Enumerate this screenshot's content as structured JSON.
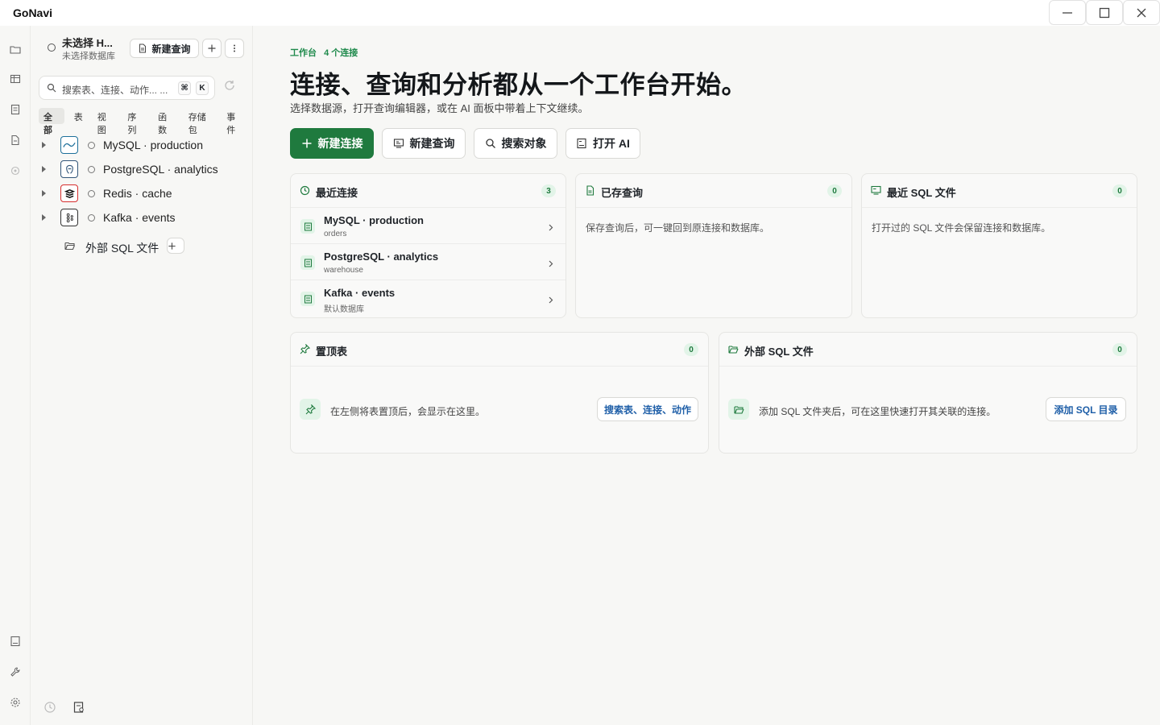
{
  "app": {
    "title": "GoNavi"
  },
  "window_controls": [
    "minimize-icon",
    "maximize-icon",
    "close-icon"
  ],
  "rail": {
    "top_icons": [
      "folder-icon",
      "table-icon",
      "list-icon",
      "document-icon",
      "target-icon"
    ],
    "bottom_icons": [
      "ai-panel-icon",
      "wrench-icon",
      "gear-icon"
    ]
  },
  "sidebar": {
    "connection_name": "未选择 H...",
    "connection_db": "未选择数据库",
    "new_query_label": "新建查询",
    "search_placeholder": "搜索表、连接、动作... ...",
    "kbd_cmd": "⌘",
    "kbd_k": "K",
    "filters": [
      "全部",
      "表",
      "视图",
      "序列",
      "函数",
      "存储包",
      "事件"
    ],
    "active_filter": "全部",
    "tree": [
      {
        "label": "MySQL · production",
        "logo": "mysql"
      },
      {
        "label": "PostgreSQL · analytics",
        "logo": "postgresql"
      },
      {
        "label": "Redis · cache",
        "logo": "redis"
      },
      {
        "label": "Kafka · events",
        "logo": "kafka"
      }
    ],
    "external_sql_label": "外部 SQL 文件"
  },
  "main": {
    "crumb_workspace": "工作台",
    "crumb_count": "4 个连接",
    "hero": "连接、查询和分析都从一个工作台开始。",
    "subtitle": "选择数据源，打开查询编辑器，或在 AI 面板中带着上下文继续。",
    "buttons": {
      "new_connection": "新建连接",
      "new_query": "新建查询",
      "search_objects": "搜索对象",
      "open_ai": "打开 AI"
    },
    "recent_connections": {
      "title": "最近连接",
      "count": "3",
      "items": [
        {
          "name": "MySQL · production",
          "db": "orders"
        },
        {
          "name": "PostgreSQL · analytics",
          "db": "warehouse"
        },
        {
          "name": "Kafka · events",
          "db": "默认数据库"
        }
      ]
    },
    "saved_queries": {
      "title": "已存查询",
      "count": "0",
      "empty": "保存查询后，可一键回到原连接和数据库。"
    },
    "recent_sql_files": {
      "title": "最近 SQL 文件",
      "count": "0",
      "empty": "打开过的 SQL 文件会保留连接和数据库。"
    },
    "pinned_tables": {
      "title": "置顶表",
      "count": "0",
      "empty": "在左侧将表置顶后，会显示在这里。",
      "action": "搜索表、连接、动作"
    },
    "external_sql": {
      "title": "外部 SQL 文件",
      "count": "0",
      "empty": "添加 SQL 文件夹后，可在这里快速打开其关联的连接。",
      "action": "添加 SQL 目录"
    }
  },
  "colors": {
    "accent": "#1f7a3e",
    "accent_soft": "#e2f4e8",
    "link": "#1f5fa8"
  }
}
